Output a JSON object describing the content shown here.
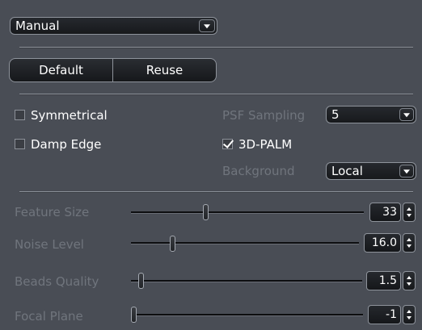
{
  "mode_select": {
    "value": "Manual",
    "icon": "chevron-down-icon"
  },
  "buttons": {
    "default_label": "Default",
    "reuse_label": "Reuse"
  },
  "options": {
    "symmetrical": {
      "label": "Symmetrical",
      "checked": false
    },
    "damp_edge": {
      "label": "Damp Edge",
      "checked": false
    },
    "psf_sampling": {
      "label": "PSF Sampling",
      "value": "5"
    },
    "palm_3d": {
      "label": "3D-PALM",
      "checked": true
    },
    "background": {
      "label": "Background",
      "value": "Local"
    }
  },
  "sliders": [
    {
      "label": "Feature Size",
      "value": "33",
      "fraction": 0.31
    },
    {
      "label": "Noise Level",
      "value": "16.0",
      "fraction": 0.17
    },
    {
      "label": "Beads Quality",
      "value": "1.5",
      "fraction": 0.03
    },
    {
      "label": "Focal Plane",
      "value": "-1",
      "fraction": 0.0
    }
  ],
  "colors": {
    "panel_bg": "#494d55",
    "control_bg": "#1b1d20",
    "border": "#8e939b",
    "dim_text": "#70757d",
    "text": "#ffffff"
  }
}
